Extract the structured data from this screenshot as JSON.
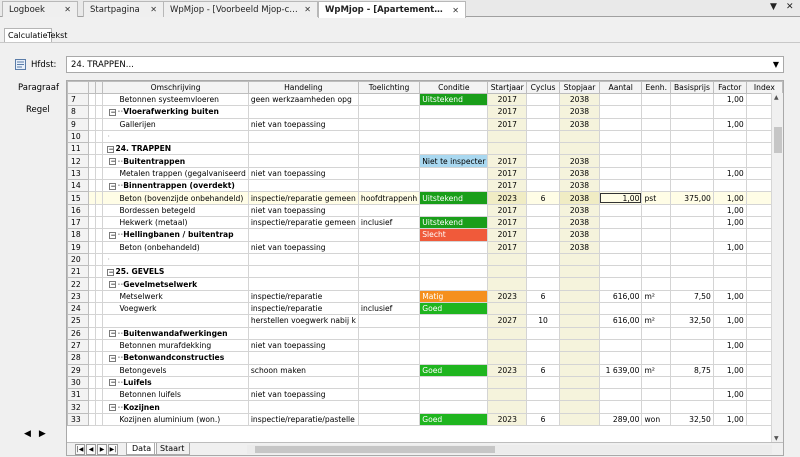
{
  "document_tabs": [
    {
      "label": "Logboek",
      "active": false
    },
    {
      "label": "Startpagina",
      "active": false
    },
    {
      "label": "WpMjop - [Voorbeeld Mjop-calc...",
      "active": false
    },
    {
      "label": "WpMjop - [Apartementen.mjop]",
      "active": true
    }
  ],
  "window_controls": {
    "dropdown": "▼",
    "close": "✕"
  },
  "sub_tabs": [
    {
      "label": "Calculatie",
      "active": true
    },
    {
      "label": "Tekst",
      "active": false
    }
  ],
  "hfdst": {
    "label": "Hfdst:",
    "value": "24. TRAPPEN...",
    "arrow": "▼"
  },
  "side_buttons": {
    "paragraaf": "Paragraaf",
    "regel": "Regel"
  },
  "side_nav": {
    "prev": "◀",
    "next": "▶"
  },
  "columns": [
    "",
    "",
    "",
    "Omschrijving",
    "Handeling",
    "Toelichting",
    "Conditie",
    "Startjaar",
    "Cyclus",
    "Stopjaar",
    "Aantal",
    "Eenh.",
    "Basisprijs",
    "Factor",
    "Index"
  ],
  "rows": [
    {
      "n": "7",
      "indent": 2,
      "omschrijving": "Betonnen systeemvloeren",
      "handeling": "geen werkzaamheden opg",
      "toelichting": "",
      "conditie": "Uitstekend",
      "cond_class": "cond-uitst",
      "startjaar": "2017",
      "cyclus": "",
      "stopjaar": "2038",
      "aantal": "",
      "eenh": "",
      "basisprijs": "",
      "factor": "1,00",
      "index": "",
      "type": "item"
    },
    {
      "n": "8",
      "indent": 1,
      "omschrijving": "Vloerafwerking buiten",
      "handeling": "",
      "toelichting": "",
      "conditie": "",
      "cond_class": "",
      "startjaar": "2017",
      "cyclus": "",
      "stopjaar": "2038",
      "aantal": "",
      "eenh": "",
      "basisprijs": "",
      "factor": "",
      "index": "",
      "type": "group"
    },
    {
      "n": "9",
      "indent": 2,
      "omschrijving": "Gallerijen",
      "handeling": "niet van toepassing",
      "toelichting": "",
      "conditie": "",
      "cond_class": "",
      "startjaar": "2017",
      "cyclus": "",
      "stopjaar": "2038",
      "aantal": "",
      "eenh": "",
      "basisprijs": "",
      "factor": "1,00",
      "index": "",
      "type": "item"
    },
    {
      "n": "10",
      "indent": 0,
      "omschrijving": "",
      "handeling": "",
      "toelichting": "",
      "conditie": "",
      "cond_class": "",
      "startjaar": "",
      "cyclus": "",
      "stopjaar": "",
      "aantal": "",
      "eenh": "",
      "basisprijs": "",
      "factor": "",
      "index": "",
      "type": "blank"
    },
    {
      "n": "11",
      "indent": 0,
      "omschrijving": "24. TRAPPEN",
      "handeling": "",
      "toelichting": "",
      "conditie": "",
      "cond_class": "",
      "startjaar": "",
      "cyclus": "",
      "stopjaar": "",
      "aantal": "",
      "eenh": "",
      "basisprijs": "",
      "factor": "",
      "index": "",
      "type": "chapter"
    },
    {
      "n": "12",
      "indent": 1,
      "omschrijving": "Buitentrappen",
      "handeling": "",
      "toelichting": "",
      "conditie": "Niet te inspecter",
      "cond_class": "cond-niet",
      "startjaar": "2017",
      "cyclus": "",
      "stopjaar": "2038",
      "aantal": "",
      "eenh": "",
      "basisprijs": "",
      "factor": "",
      "index": "",
      "type": "group"
    },
    {
      "n": "13",
      "indent": 2,
      "omschrijving": "Metalen trappen (gegalvaniseerd",
      "handeling": "niet van toepassing",
      "toelichting": "",
      "conditie": "",
      "cond_class": "",
      "startjaar": "2017",
      "cyclus": "",
      "stopjaar": "2038",
      "aantal": "",
      "eenh": "",
      "basisprijs": "",
      "factor": "1,00",
      "index": "",
      "type": "item"
    },
    {
      "n": "14",
      "indent": 1,
      "omschrijving": "Binnentrappen (overdekt)",
      "handeling": "",
      "toelichting": "",
      "conditie": "",
      "cond_class": "",
      "startjaar": "2017",
      "cyclus": "",
      "stopjaar": "2038",
      "aantal": "",
      "eenh": "",
      "basisprijs": "",
      "factor": "",
      "index": "",
      "type": "group"
    },
    {
      "n": "15",
      "indent": 2,
      "omschrijving": "Beton (bovenzijde onbehandeld)",
      "handeling": "inspectie/reparatie gemeen",
      "toelichting": "hoofdtrappenh",
      "conditie": "Uitstekend",
      "cond_class": "cond-uitst",
      "startjaar": "2023",
      "cyclus": "6",
      "stopjaar": "2038",
      "aantal": "1,00",
      "eenh": "pst",
      "basisprijs": "375,00",
      "factor": "1,00",
      "index": "",
      "type": "item",
      "selected": true
    },
    {
      "n": "16",
      "indent": 2,
      "omschrijving": "Bordessen betegeld",
      "handeling": "niet van toepassing",
      "toelichting": "",
      "conditie": "",
      "cond_class": "",
      "startjaar": "2017",
      "cyclus": "",
      "stopjaar": "2038",
      "aantal": "",
      "eenh": "",
      "basisprijs": "",
      "factor": "1,00",
      "index": "",
      "type": "item"
    },
    {
      "n": "17",
      "indent": 2,
      "omschrijving": "Hekwerk (metaal)",
      "handeling": "inspectie/reparatie gemeen",
      "toelichting": "inclusief",
      "conditie": "Uitstekend",
      "cond_class": "cond-uitst",
      "startjaar": "2017",
      "cyclus": "",
      "stopjaar": "2038",
      "aantal": "",
      "eenh": "",
      "basisprijs": "",
      "factor": "1,00",
      "index": "",
      "type": "item"
    },
    {
      "n": "18",
      "indent": 1,
      "omschrijving": "Hellingbanen / buitentrap",
      "handeling": "",
      "toelichting": "",
      "conditie": "Slecht",
      "cond_class": "cond-slecht",
      "startjaar": "2017",
      "cyclus": "",
      "stopjaar": "2038",
      "aantal": "",
      "eenh": "",
      "basisprijs": "",
      "factor": "",
      "index": "",
      "type": "group"
    },
    {
      "n": "19",
      "indent": 2,
      "omschrijving": "Beton (onbehandeld)",
      "handeling": "niet van toepassing",
      "toelichting": "",
      "conditie": "",
      "cond_class": "",
      "startjaar": "2017",
      "cyclus": "",
      "stopjaar": "2038",
      "aantal": "",
      "eenh": "",
      "basisprijs": "",
      "factor": "1,00",
      "index": "",
      "type": "item"
    },
    {
      "n": "20",
      "indent": 0,
      "omschrijving": "",
      "handeling": "",
      "toelichting": "",
      "conditie": "",
      "cond_class": "",
      "startjaar": "",
      "cyclus": "",
      "stopjaar": "",
      "aantal": "",
      "eenh": "",
      "basisprijs": "",
      "factor": "",
      "index": "",
      "type": "blank"
    },
    {
      "n": "21",
      "indent": 0,
      "omschrijving": "25. GEVELS",
      "handeling": "",
      "toelichting": "",
      "conditie": "",
      "cond_class": "",
      "startjaar": "",
      "cyclus": "",
      "stopjaar": "",
      "aantal": "",
      "eenh": "",
      "basisprijs": "",
      "factor": "",
      "index": "",
      "type": "chapter"
    },
    {
      "n": "22",
      "indent": 1,
      "omschrijving": "Gevelmetselwerk",
      "handeling": "",
      "toelichting": "",
      "conditie": "",
      "cond_class": "",
      "startjaar": "",
      "cyclus": "",
      "stopjaar": "",
      "aantal": "",
      "eenh": "",
      "basisprijs": "",
      "factor": "",
      "index": "",
      "type": "group"
    },
    {
      "n": "23",
      "indent": 2,
      "omschrijving": "Metselwerk",
      "handeling": "inspectie/reparatie",
      "toelichting": "",
      "conditie": "Matig",
      "cond_class": "cond-matig",
      "startjaar": "2023",
      "cyclus": "6",
      "stopjaar": "",
      "aantal": "616,00",
      "eenh": "m²",
      "basisprijs": "7,50",
      "factor": "1,00",
      "index": "",
      "type": "item"
    },
    {
      "n": "24",
      "indent": 2,
      "omschrijving": "Voegwerk",
      "handeling": "inspectie/reparatie",
      "toelichting": "inclusief",
      "conditie": "Goed",
      "cond_class": "cond-good",
      "startjaar": "",
      "cyclus": "",
      "stopjaar": "",
      "aantal": "",
      "eenh": "",
      "basisprijs": "",
      "factor": "",
      "index": "",
      "type": "item"
    },
    {
      "n": "25",
      "indent": 2,
      "omschrijving": "",
      "handeling": "herstellen voegwerk nabij k",
      "toelichting": "",
      "conditie": "",
      "cond_class": "",
      "startjaar": "2027",
      "cyclus": "10",
      "stopjaar": "",
      "aantal": "616,00",
      "eenh": "m²",
      "basisprijs": "32,50",
      "factor": "1,00",
      "index": "",
      "type": "item"
    },
    {
      "n": "26",
      "indent": 1,
      "omschrijving": "Buitenwandafwerkingen",
      "handeling": "",
      "toelichting": "",
      "conditie": "",
      "cond_class": "",
      "startjaar": "",
      "cyclus": "",
      "stopjaar": "",
      "aantal": "",
      "eenh": "",
      "basisprijs": "",
      "factor": "",
      "index": "",
      "type": "group"
    },
    {
      "n": "27",
      "indent": 2,
      "omschrijving": "Betonnen murafdekking",
      "handeling": "niet van toepassing",
      "toelichting": "",
      "conditie": "",
      "cond_class": "",
      "startjaar": "",
      "cyclus": "",
      "stopjaar": "",
      "aantal": "",
      "eenh": "",
      "basisprijs": "",
      "factor": "1,00",
      "index": "",
      "type": "item"
    },
    {
      "n": "28",
      "indent": 1,
      "omschrijving": "Betonwandconstructies",
      "handeling": "",
      "toelichting": "",
      "conditie": "",
      "cond_class": "",
      "startjaar": "",
      "cyclus": "",
      "stopjaar": "",
      "aantal": "",
      "eenh": "",
      "basisprijs": "",
      "factor": "",
      "index": "",
      "type": "group"
    },
    {
      "n": "29",
      "indent": 2,
      "omschrijving": "Betongevels",
      "handeling": "schoon maken",
      "toelichting": "",
      "conditie": "Goed",
      "cond_class": "cond-good",
      "startjaar": "2023",
      "cyclus": "6",
      "stopjaar": "",
      "aantal": "1 639,00",
      "eenh": "m²",
      "basisprijs": "8,75",
      "factor": "1,00",
      "index": "",
      "type": "item"
    },
    {
      "n": "30",
      "indent": 1,
      "omschrijving": "Luifels",
      "handeling": "",
      "toelichting": "",
      "conditie": "",
      "cond_class": "",
      "startjaar": "",
      "cyclus": "",
      "stopjaar": "",
      "aantal": "",
      "eenh": "",
      "basisprijs": "",
      "factor": "",
      "index": "",
      "type": "group"
    },
    {
      "n": "31",
      "indent": 2,
      "omschrijving": "Betonnen luifels",
      "handeling": "niet van toepassing",
      "toelichting": "",
      "conditie": "",
      "cond_class": "",
      "startjaar": "",
      "cyclus": "",
      "stopjaar": "",
      "aantal": "",
      "eenh": "",
      "basisprijs": "",
      "factor": "1,00",
      "index": "",
      "type": "item"
    },
    {
      "n": "32",
      "indent": 1,
      "omschrijving": "Kozijnen",
      "handeling": "",
      "toelichting": "",
      "conditie": "",
      "cond_class": "",
      "startjaar": "",
      "cyclus": "",
      "stopjaar": "",
      "aantal": "",
      "eenh": "",
      "basisprijs": "",
      "factor": "",
      "index": "",
      "type": "group"
    },
    {
      "n": "33",
      "indent": 2,
      "omschrijving": "Kozijnen aluminium (won.)",
      "handeling": "inspectie/reparatie/pastelle",
      "toelichting": "",
      "conditie": "Goed",
      "cond_class": "cond-good",
      "startjaar": "2023",
      "cyclus": "6",
      "stopjaar": "",
      "aantal": "289,00",
      "eenh": "won",
      "basisprijs": "32,50",
      "factor": "1,00",
      "index": "",
      "type": "item"
    }
  ],
  "sheet_tabs": [
    {
      "label": "Data",
      "active": true
    },
    {
      "label": "Staart",
      "active": false
    }
  ],
  "sheet_nav": [
    "|◀",
    "◀",
    "▶",
    "▶|"
  ],
  "colors": {
    "uitstekend": "#1a9e1a",
    "goed": "#1fb51f",
    "matig": "#f5901e",
    "slecht": "#f05a3a",
    "niet_te_inspecteren": "#a9d8f0",
    "year_column": "#f5f3dc"
  }
}
